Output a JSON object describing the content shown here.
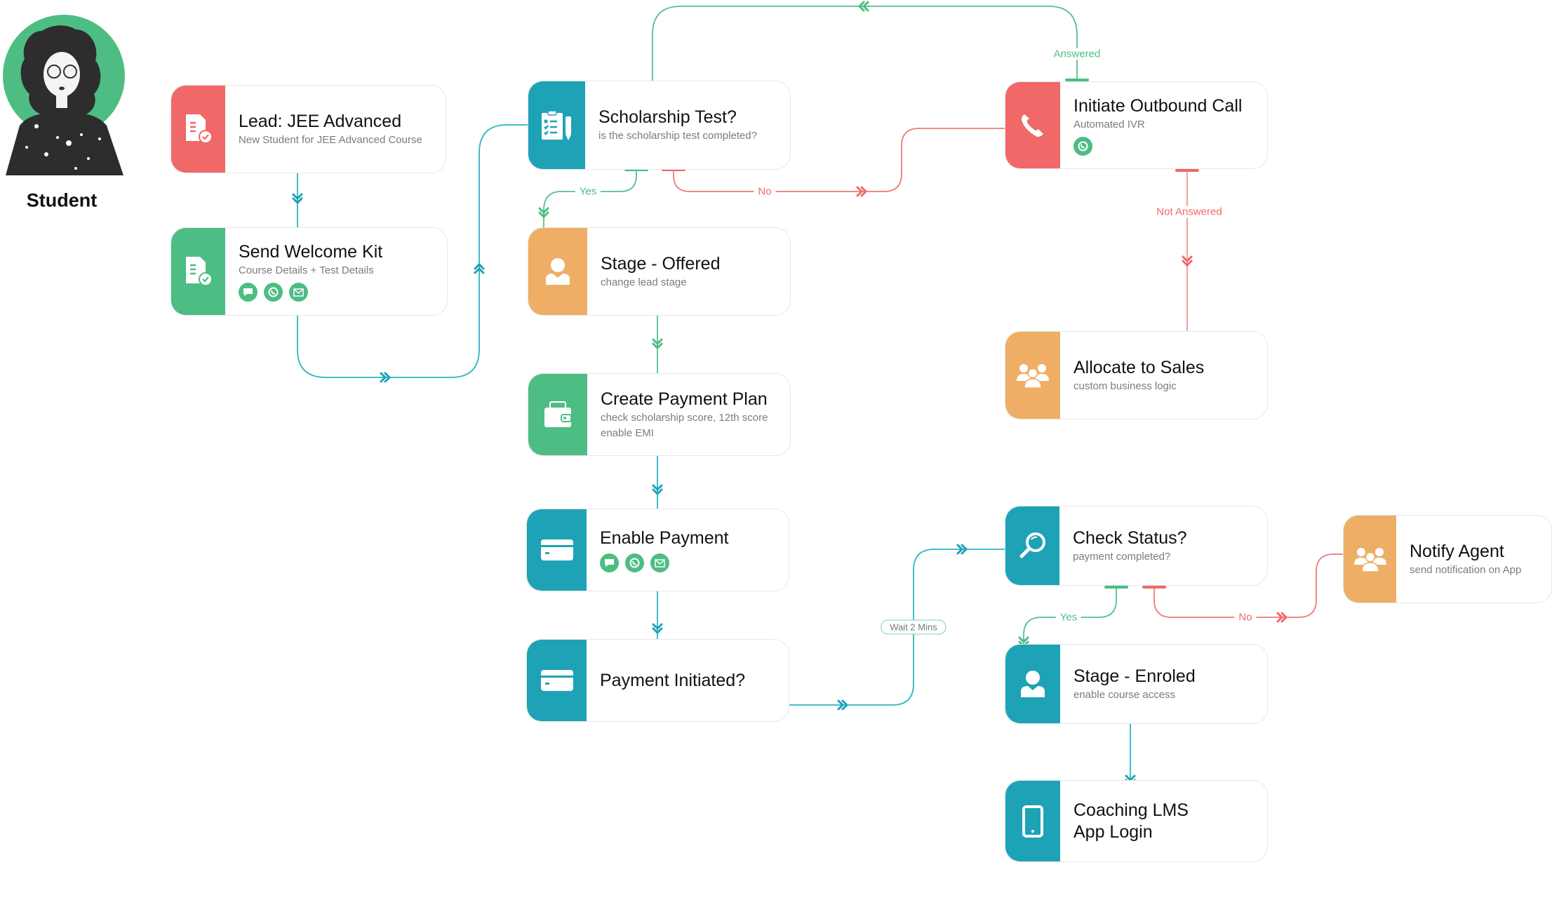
{
  "actor": {
    "label": "Student",
    "icon": "student-avatar"
  },
  "colors": {
    "red": "#f06868",
    "green": "#4dbd83",
    "teal": "#1ea2b6",
    "orange": "#eeae66",
    "teal_line": "#2bb5c4",
    "green_line": "#56c08a",
    "red_line": "#f07a7a"
  },
  "nodes": {
    "lead": {
      "title": "Lead: JEE Advanced",
      "subtitle": "New Student for JEE Advanced Course",
      "icon": "document-check-icon",
      "color": "red"
    },
    "welcome": {
      "title": "Send Welcome Kit",
      "subtitle": "Course Details + Test Details",
      "icon": "document-check-icon",
      "color": "green",
      "channels": [
        "sms-icon",
        "whatsapp-icon",
        "email-icon"
      ]
    },
    "scholarship": {
      "title": "Scholarship Test?",
      "subtitle": "is the scholarship test completed?",
      "icon": "clipboard-checklist-icon",
      "color": "teal"
    },
    "offered": {
      "title": "Stage - Offered",
      "subtitle": "change lead stage",
      "icon": "user-icon",
      "color": "orange"
    },
    "payplan": {
      "title": "Create Payment Plan",
      "subtitle": "check scholarship score, 12th score",
      "subtitle2": "enable EMI",
      "icon": "wallet-icon",
      "color": "green"
    },
    "enablepay": {
      "title": "Enable Payment",
      "icon": "credit-card-icon",
      "color": "teal",
      "channels": [
        "sms-icon",
        "whatsapp-icon",
        "email-icon"
      ]
    },
    "payinit": {
      "title": "Payment Initiated?",
      "icon": "credit-card-icon",
      "color": "teal"
    },
    "outbound": {
      "title": "Initiate Outbound Call",
      "subtitle": "Automated IVR",
      "icon": "phone-icon",
      "color": "red",
      "channels": [
        "whatsapp-icon"
      ]
    },
    "allocate": {
      "title": "Allocate to Sales",
      "subtitle": "custom business logic",
      "icon": "group-icon",
      "color": "orange"
    },
    "checkstatus": {
      "title": "Check Status?",
      "subtitle": "payment completed?",
      "icon": "magnifier-icon",
      "color": "teal"
    },
    "notify": {
      "title": "Notify Agent",
      "subtitle": "send notification on App",
      "icon": "group-icon",
      "color": "orange"
    },
    "enroled": {
      "title": "Stage - Enroled",
      "subtitle": "enable course access",
      "icon": "user-icon",
      "color": "teal"
    },
    "lms": {
      "title": "Coaching LMS",
      "title2": "App Login",
      "icon": "mobile-phone-icon",
      "color": "teal"
    }
  },
  "edges": {
    "scholarship_yes": "Yes",
    "scholarship_no": "No",
    "call_answered": "Answered",
    "call_not_answered": "Not Answered",
    "wait": "Wait 2 Mins",
    "status_yes": "Yes",
    "status_no": "No"
  }
}
